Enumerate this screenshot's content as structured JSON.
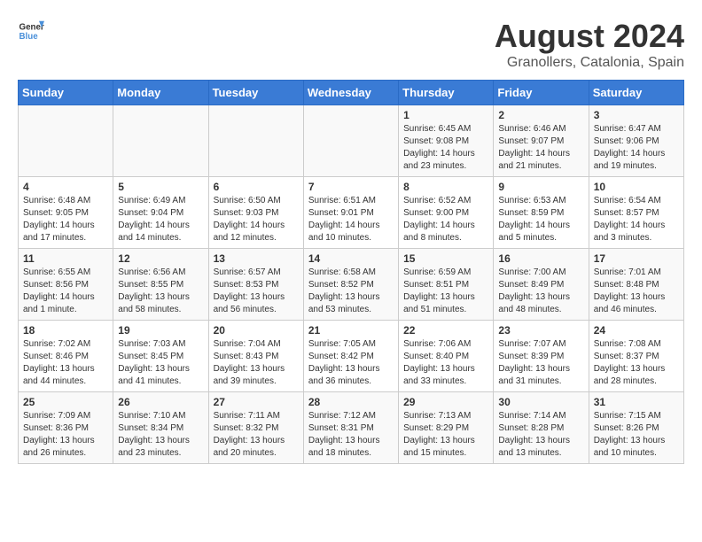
{
  "header": {
    "logo_general": "General",
    "logo_blue": "Blue",
    "month_year": "August 2024",
    "location": "Granollers, Catalonia, Spain"
  },
  "days_of_week": [
    "Sunday",
    "Monday",
    "Tuesday",
    "Wednesday",
    "Thursday",
    "Friday",
    "Saturday"
  ],
  "weeks": [
    [
      {
        "day": "",
        "info": ""
      },
      {
        "day": "",
        "info": ""
      },
      {
        "day": "",
        "info": ""
      },
      {
        "day": "",
        "info": ""
      },
      {
        "day": "1",
        "info": "Sunrise: 6:45 AM\nSunset: 9:08 PM\nDaylight: 14 hours\nand 23 minutes."
      },
      {
        "day": "2",
        "info": "Sunrise: 6:46 AM\nSunset: 9:07 PM\nDaylight: 14 hours\nand 21 minutes."
      },
      {
        "day": "3",
        "info": "Sunrise: 6:47 AM\nSunset: 9:06 PM\nDaylight: 14 hours\nand 19 minutes."
      }
    ],
    [
      {
        "day": "4",
        "info": "Sunrise: 6:48 AM\nSunset: 9:05 PM\nDaylight: 14 hours\nand 17 minutes."
      },
      {
        "day": "5",
        "info": "Sunrise: 6:49 AM\nSunset: 9:04 PM\nDaylight: 14 hours\nand 14 minutes."
      },
      {
        "day": "6",
        "info": "Sunrise: 6:50 AM\nSunset: 9:03 PM\nDaylight: 14 hours\nand 12 minutes."
      },
      {
        "day": "7",
        "info": "Sunrise: 6:51 AM\nSunset: 9:01 PM\nDaylight: 14 hours\nand 10 minutes."
      },
      {
        "day": "8",
        "info": "Sunrise: 6:52 AM\nSunset: 9:00 PM\nDaylight: 14 hours\nand 8 minutes."
      },
      {
        "day": "9",
        "info": "Sunrise: 6:53 AM\nSunset: 8:59 PM\nDaylight: 14 hours\nand 5 minutes."
      },
      {
        "day": "10",
        "info": "Sunrise: 6:54 AM\nSunset: 8:57 PM\nDaylight: 14 hours\nand 3 minutes."
      }
    ],
    [
      {
        "day": "11",
        "info": "Sunrise: 6:55 AM\nSunset: 8:56 PM\nDaylight: 14 hours\nand 1 minute."
      },
      {
        "day": "12",
        "info": "Sunrise: 6:56 AM\nSunset: 8:55 PM\nDaylight: 13 hours\nand 58 minutes."
      },
      {
        "day": "13",
        "info": "Sunrise: 6:57 AM\nSunset: 8:53 PM\nDaylight: 13 hours\nand 56 minutes."
      },
      {
        "day": "14",
        "info": "Sunrise: 6:58 AM\nSunset: 8:52 PM\nDaylight: 13 hours\nand 53 minutes."
      },
      {
        "day": "15",
        "info": "Sunrise: 6:59 AM\nSunset: 8:51 PM\nDaylight: 13 hours\nand 51 minutes."
      },
      {
        "day": "16",
        "info": "Sunrise: 7:00 AM\nSunset: 8:49 PM\nDaylight: 13 hours\nand 48 minutes."
      },
      {
        "day": "17",
        "info": "Sunrise: 7:01 AM\nSunset: 8:48 PM\nDaylight: 13 hours\nand 46 minutes."
      }
    ],
    [
      {
        "day": "18",
        "info": "Sunrise: 7:02 AM\nSunset: 8:46 PM\nDaylight: 13 hours\nand 44 minutes."
      },
      {
        "day": "19",
        "info": "Sunrise: 7:03 AM\nSunset: 8:45 PM\nDaylight: 13 hours\nand 41 minutes."
      },
      {
        "day": "20",
        "info": "Sunrise: 7:04 AM\nSunset: 8:43 PM\nDaylight: 13 hours\nand 39 minutes."
      },
      {
        "day": "21",
        "info": "Sunrise: 7:05 AM\nSunset: 8:42 PM\nDaylight: 13 hours\nand 36 minutes."
      },
      {
        "day": "22",
        "info": "Sunrise: 7:06 AM\nSunset: 8:40 PM\nDaylight: 13 hours\nand 33 minutes."
      },
      {
        "day": "23",
        "info": "Sunrise: 7:07 AM\nSunset: 8:39 PM\nDaylight: 13 hours\nand 31 minutes."
      },
      {
        "day": "24",
        "info": "Sunrise: 7:08 AM\nSunset: 8:37 PM\nDaylight: 13 hours\nand 28 minutes."
      }
    ],
    [
      {
        "day": "25",
        "info": "Sunrise: 7:09 AM\nSunset: 8:36 PM\nDaylight: 13 hours\nand 26 minutes."
      },
      {
        "day": "26",
        "info": "Sunrise: 7:10 AM\nSunset: 8:34 PM\nDaylight: 13 hours\nand 23 minutes."
      },
      {
        "day": "27",
        "info": "Sunrise: 7:11 AM\nSunset: 8:32 PM\nDaylight: 13 hours\nand 20 minutes."
      },
      {
        "day": "28",
        "info": "Sunrise: 7:12 AM\nSunset: 8:31 PM\nDaylight: 13 hours\nand 18 minutes."
      },
      {
        "day": "29",
        "info": "Sunrise: 7:13 AM\nSunset: 8:29 PM\nDaylight: 13 hours\nand 15 minutes."
      },
      {
        "day": "30",
        "info": "Sunrise: 7:14 AM\nSunset: 8:28 PM\nDaylight: 13 hours\nand 13 minutes."
      },
      {
        "day": "31",
        "info": "Sunrise: 7:15 AM\nSunset: 8:26 PM\nDaylight: 13 hours\nand 10 minutes."
      }
    ]
  ]
}
